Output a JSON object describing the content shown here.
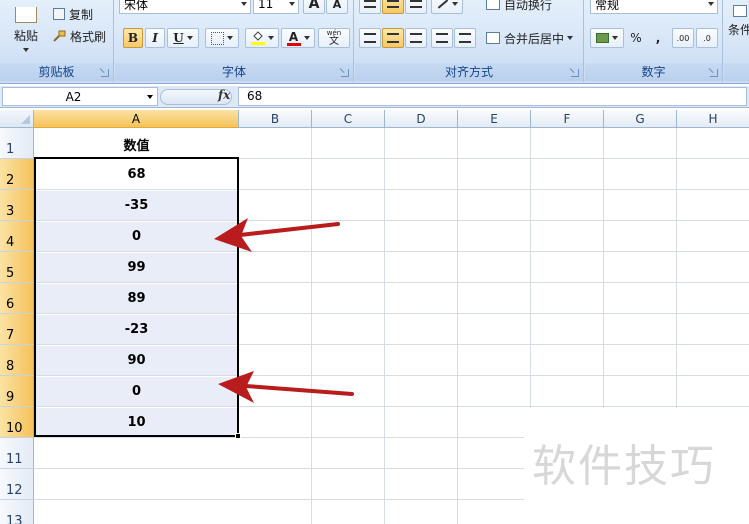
{
  "ribbon": {
    "clipboard": {
      "label": "剪贴板",
      "paste": "粘贴",
      "copy": "复制",
      "format_painter": "格式刷"
    },
    "font": {
      "label": "字体",
      "font_name": "宋体",
      "font_size": "11",
      "grow": "A",
      "shrink": "A",
      "bold": "B",
      "italic": "I",
      "underline": "U",
      "font_color_glyph": "A",
      "phonetic": "wén"
    },
    "alignment": {
      "label": "对齐方式",
      "wrap_text": "自动换行",
      "merge_center": "合并后居中"
    },
    "number": {
      "label": "数字",
      "format": "常规",
      "percent": "%",
      "comma": ",",
      "inc_decimal": ".00",
      "dec_decimal": ".0"
    },
    "styles": {
      "conditional_partial": "条件"
    }
  },
  "formula_bar": {
    "name_box": "A2",
    "fx": "fx",
    "value": "68"
  },
  "grid": {
    "columns": [
      "A",
      "B",
      "C",
      "D",
      "E",
      "F",
      "G",
      "H"
    ],
    "rows": [
      "1",
      "2",
      "3",
      "4",
      "5",
      "6",
      "7",
      "8",
      "9",
      "10",
      "11",
      "12",
      "13"
    ],
    "header_cell": "数值",
    "values": [
      "68",
      "-35",
      "0",
      "99",
      "89",
      "-23",
      "90",
      "0",
      "10"
    ]
  },
  "annotations": {
    "arrow_color": "#b81c1c"
  },
  "watermark": "软件技巧",
  "colors": {
    "ribbon_bg": "#d6e5f7",
    "group_label": "#15428b",
    "selected_header": "#f5c25a",
    "selection_fill": "#e9edf7"
  }
}
